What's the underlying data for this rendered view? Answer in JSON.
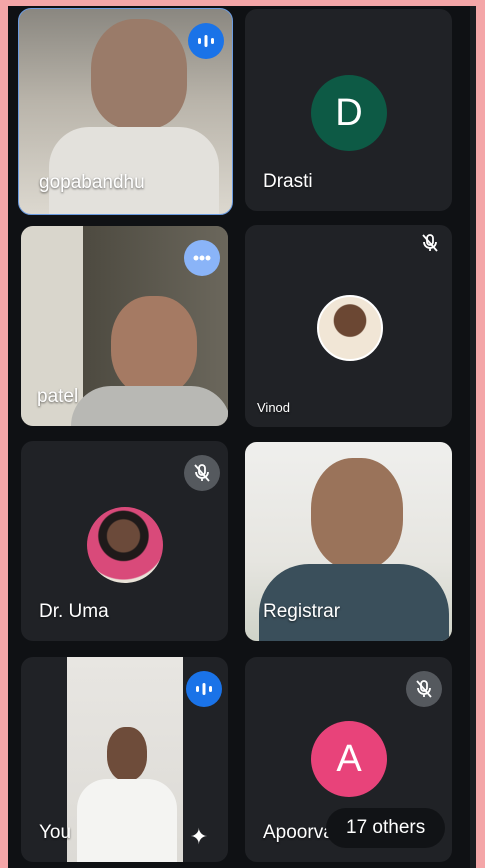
{
  "participants": [
    {
      "name": "gopabandhu",
      "type": "video",
      "speaking": true
    },
    {
      "name": "Drasti",
      "type": "avatar",
      "initial": "D",
      "color": "#0d5a45"
    },
    {
      "name": "patel",
      "type": "video",
      "speaking": true
    },
    {
      "name": "Vinod",
      "type": "photo",
      "muted": true
    },
    {
      "name": "Dr. Uma",
      "type": "photo",
      "muted": true
    },
    {
      "name": "Registrar",
      "type": "video"
    },
    {
      "name": "You",
      "type": "video",
      "speaking": true
    },
    {
      "name": "Apoorva",
      "type": "avatar",
      "initial": "A",
      "color": "#e8437a",
      "muted": true
    }
  ],
  "others_label": "17 others",
  "icons": {
    "speaking": "audio-level-icon",
    "muted": "mic-off-icon",
    "effects": "sparkle-icon"
  }
}
